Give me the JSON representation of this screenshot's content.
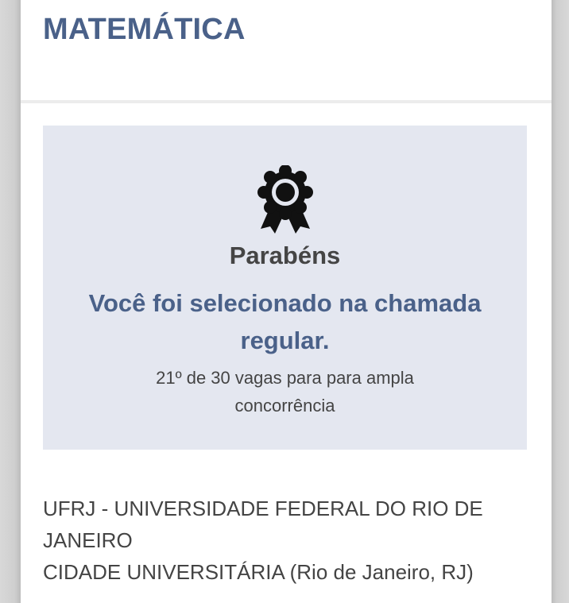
{
  "course": {
    "title": "MATEMÁTICA"
  },
  "result": {
    "icon": "award-ribbon-icon",
    "congrats": "Parabéns",
    "message": "Você foi selecionado na chamada regular.",
    "vacancy": "21º de 30 vagas para para ampla concorrência"
  },
  "institution": {
    "name": "UFRJ - UNIVERSIDADE FEDERAL DO RIO DE JANEIRO",
    "campus": "CIDADE UNIVERSITÁRIA (Rio de Janeiro, RJ)"
  },
  "colors": {
    "accent": "#4a6189",
    "box_background": "#e4e7f0",
    "text_dark": "#444444"
  }
}
